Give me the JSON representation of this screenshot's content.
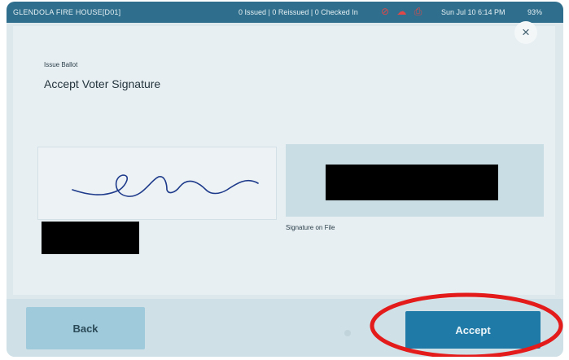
{
  "status_bar": {
    "location": "GLENDOLA FIRE HOUSE[D01]",
    "counts": "0 Issued | 0 Reissued | 0 Checked In",
    "datetime": "Sun Jul 10  6:14 PM",
    "battery": "93%",
    "icons": [
      "no-sync-icon",
      "cloud-icon",
      "printer-icon"
    ]
  },
  "header": {
    "breadcrumb": "Issue Ballot",
    "title": "Accept Voter Signature"
  },
  "signature": {
    "file_caption": "Signature on File"
  },
  "buttons": {
    "close": "×",
    "back": "Back",
    "accept": "Accept"
  },
  "colors": {
    "status_bar": "#2f6f8d",
    "accept": "#1f7aa8",
    "back": "#9fcadb",
    "highlight": "#e31b1b"
  }
}
